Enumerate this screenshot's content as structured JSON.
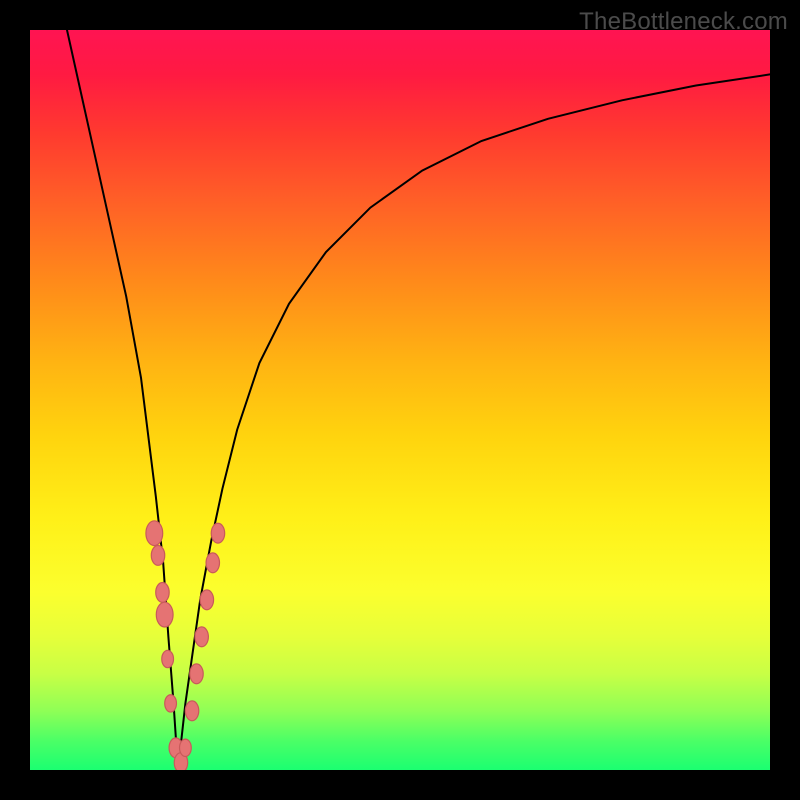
{
  "watermark": "TheBottleneck.com",
  "chart_data": {
    "type": "line",
    "title": "",
    "xlabel": "",
    "ylabel": "",
    "xlim": [
      0,
      100
    ],
    "ylim": [
      0,
      100
    ],
    "legend": false,
    "grid": false,
    "series": [
      {
        "name": "bottleneck-curve",
        "x": [
          5,
          7,
          9,
          11,
          13,
          15,
          16,
          17,
          18,
          18.7,
          19.4,
          20,
          21,
          22,
          23,
          24.5,
          26,
          28,
          31,
          35,
          40,
          46,
          53,
          61,
          70,
          80,
          90,
          100
        ],
        "values": [
          100,
          91,
          82,
          73,
          64,
          53,
          45,
          37,
          28,
          18,
          9,
          0,
          9,
          16,
          23,
          31,
          38,
          46,
          55,
          63,
          70,
          76,
          81,
          85,
          88,
          90.5,
          92.5,
          94
        ]
      }
    ],
    "markers": {
      "name": "sample-points",
      "points": [
        {
          "x": 16.8,
          "y": 32,
          "r": 2.0
        },
        {
          "x": 17.3,
          "y": 29,
          "r": 1.6
        },
        {
          "x": 17.9,
          "y": 24,
          "r": 1.6
        },
        {
          "x": 18.2,
          "y": 21,
          "r": 2.0
        },
        {
          "x": 18.6,
          "y": 15,
          "r": 1.4
        },
        {
          "x": 19.0,
          "y": 9,
          "r": 1.4
        },
        {
          "x": 19.7,
          "y": 3,
          "r": 1.6
        },
        {
          "x": 20.4,
          "y": 1,
          "r": 1.6
        },
        {
          "x": 21.0,
          "y": 3,
          "r": 1.4
        },
        {
          "x": 21.9,
          "y": 8,
          "r": 1.6
        },
        {
          "x": 22.5,
          "y": 13,
          "r": 1.6
        },
        {
          "x": 23.2,
          "y": 18,
          "r": 1.6
        },
        {
          "x": 23.9,
          "y": 23,
          "r": 1.6
        },
        {
          "x": 24.7,
          "y": 28,
          "r": 1.6
        },
        {
          "x": 25.4,
          "y": 32,
          "r": 1.6
        }
      ]
    },
    "colors": {
      "curve": "#000000",
      "marker_fill": "#e57373",
      "marker_stroke": "#c85a5a",
      "bg_top": "#ff1452",
      "bg_bottom": "#1bff71"
    }
  }
}
